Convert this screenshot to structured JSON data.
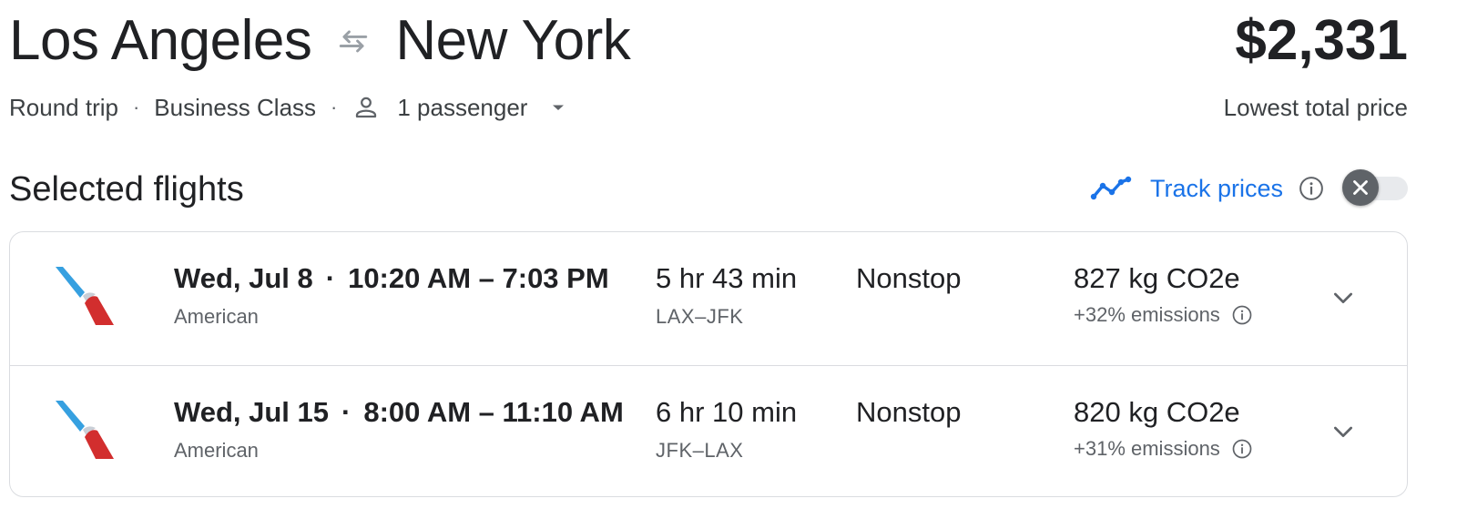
{
  "header": {
    "origin": "Los Angeles",
    "destination": "New York",
    "swap_icon": "swap-arrows-icon",
    "price": "$2,331",
    "price_label": "Lowest total price"
  },
  "trip": {
    "type": "Round trip",
    "cabin": "Business Class",
    "passengers": "1 passenger",
    "separator": "·"
  },
  "section": {
    "title": "Selected flights",
    "track_prices_label": "Track prices",
    "track_prices_enabled": false
  },
  "colors": {
    "accent": "#1a73e8",
    "text_primary": "#202124",
    "text_secondary": "#5f6368",
    "border": "#dadce0",
    "aa_blue": "#36a0e0",
    "aa_red": "#d22e2e"
  },
  "flights": [
    {
      "date": "Wed, Jul 8",
      "time_range": "10:20 AM – 7:03 PM",
      "airline": "American",
      "duration": "5 hr 43 min",
      "airports": "LAX–JFK",
      "stops": "Nonstop",
      "emissions": "827 kg CO2e",
      "emissions_delta": "+32% emissions"
    },
    {
      "date": "Wed, Jul 15",
      "time_range": "8:00 AM – 11:10 AM",
      "airline": "American",
      "duration": "6 hr 10 min",
      "airports": "JFK–LAX",
      "stops": "Nonstop",
      "emissions": "820 kg CO2e",
      "emissions_delta": "+31% emissions"
    }
  ]
}
